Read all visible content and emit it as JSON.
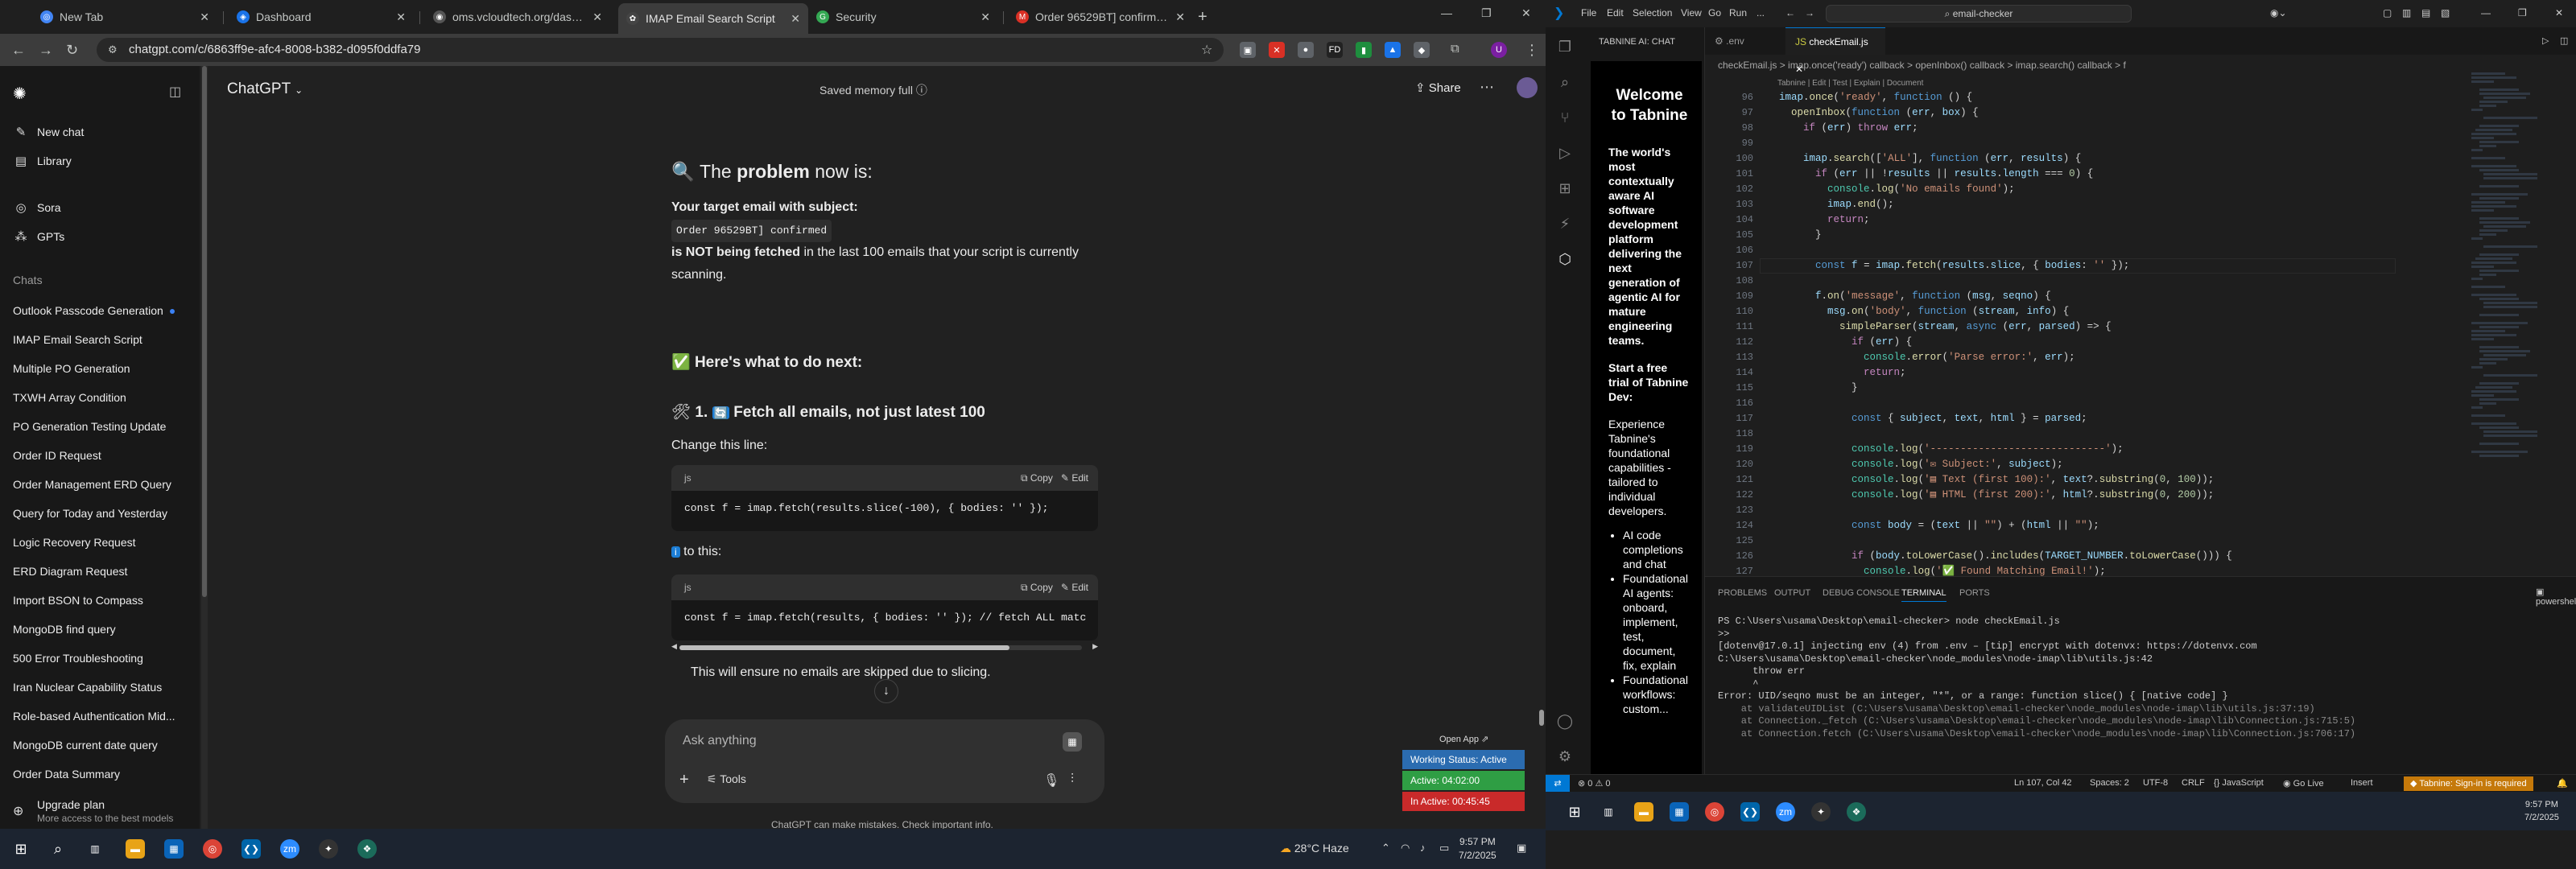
{
  "browser": {
    "tabs": [
      {
        "label": "New Tab",
        "color": "#4285f4"
      },
      {
        "label": "Dashboard",
        "color": "#1a73e8"
      },
      {
        "label": "oms.vcloudtech.org/dashboard",
        "color": "#555555"
      },
      {
        "label": "IMAP Email Search Script",
        "color": "#444444"
      },
      {
        "label": "Security",
        "color": "#34a853"
      },
      {
        "label": "Order 96529BT] confirmed - us",
        "color": "#d93025"
      }
    ],
    "new_tab_glyph": "+",
    "url": "chatgpt.com/c/6863ff9e-afc4-8008-b382-d095f0ddfa79",
    "extensions": [
      {
        "glyph": "▣",
        "color": "#5f6368"
      },
      {
        "glyph": "✕",
        "color": "#d93025"
      },
      {
        "glyph": "●",
        "color": "#5f6368"
      },
      {
        "glyph": "FD",
        "color": "#222222"
      },
      {
        "glyph": "▮",
        "color": "#1e8e3e"
      },
      {
        "glyph": "▲",
        "color": "#1a73e8"
      },
      {
        "glyph": "◆",
        "color": "#5f6368"
      }
    ]
  },
  "chatgpt": {
    "sidebar": {
      "new_chat": "New chat",
      "library": "Library",
      "sora": "Sora",
      "gpts": "GPTs",
      "chats_heading": "Chats",
      "chats": [
        "Outlook Passcode Generation",
        "IMAP Email Search Script",
        "Multiple PO Generation",
        "TXWH Array Condition",
        "PO Generation Testing Update",
        "Order ID Request",
        "Order Management ERD Query",
        "Query for Today and Yesterday",
        "Logic Recovery Request",
        "ERD Diagram Request",
        "Import BSON to Compass",
        "MongoDB find query",
        "500 Error Troubleshooting",
        "Iran Nuclear Capability Status",
        "Role-based Authentication Mid...",
        "MongoDB current date query",
        "Order Data Summary"
      ],
      "upgrade_title": "Upgrade plan",
      "upgrade_sub": "More access to the best models"
    },
    "header": {
      "model": "ChatGPT",
      "memory": "Saved memory full",
      "share": "Share"
    },
    "message": {
      "problem_heading_pre": "The",
      "problem_heading_bold": "problem",
      "problem_heading_post": "now is:",
      "target_label": "Your target email with subject:",
      "subject_code": "Order 96529BT] confirmed",
      "not_fetched_bold": "is NOT being fetched",
      "not_fetched_rest": "in the last 100 emails that your script is currently scanning.",
      "next_heading": "Here's what to do next:",
      "step1_pre": "1.",
      "step1_text": "Fetch",
      "step1_bold": "all emails",
      "step1_post": ", not just latest 100",
      "change_line": "Change this line:",
      "code1_lang": "js",
      "code1": "const f = imap.fetch(results.slice(-100), { bodies: '' });",
      "to_this": "to this:",
      "code2_lang": "js",
      "code2": "const f = imap.fetch(results, { bodies: '' }); // fetch ALL matc",
      "copy_label": "Copy",
      "edit_label": "Edit",
      "ensure_text": "This will ensure no emails are skipped due to slicing."
    },
    "composer": {
      "placeholder": "Ask anything",
      "tools": "Tools"
    },
    "disclaimer": "ChatGPT can make mistakes. Check important info.",
    "widget": {
      "open_app": "Open App",
      "working_status": "Working Status: Active",
      "active": "Active: 04:02:00",
      "in_active": "In Active: 00:45:45",
      "colors": [
        "#2b6cb0",
        "#2f9e44",
        "#c92a2a"
      ]
    }
  },
  "left_taskbar": {
    "weather": "28°C Haze",
    "time": "9:57 PM",
    "date": "7/2/2025"
  },
  "vscode": {
    "menu": [
      "File",
      "Edit",
      "Selection",
      "View",
      "Go",
      "Run",
      "..."
    ],
    "search": "email-checker",
    "chat_panel_title": "TABNINE AI: CHAT",
    "tabnine": {
      "welcome": "Welcome to Tabnine",
      "blurb": "The world's most contextually aware AI software development platform delivering the next generation of agentic AI for mature engineering teams.",
      "trial": "Start a free trial of Tabnine Dev:",
      "experience": "Experience Tabnine's foundational capabilities - tailored to individual developers.",
      "bullets": [
        "AI code completions and chat",
        "Foundational AI agents: onboard, implement, test, document, fix, explain",
        "Foundational workflows: custom..."
      ]
    },
    "tabs": [
      ".env",
      "checkEmail.js"
    ],
    "breadcrumb": "checkEmail.js > imap.once('ready') callback > openInbox() callback > imap.search() callback > f",
    "codelens": "Tabnine | Edit | Test | Explain | Document",
    "first_line": 96,
    "panel_tabs": [
      "PROBLEMS",
      "OUTPUT",
      "DEBUG CONSOLE",
      "TERMINAL",
      "PORTS"
    ],
    "shell": "powershell",
    "terminal": [
      "PS C:\\Users\\usama\\Desktop\\email-checker> node checkEmail.js",
      ">>",
      "[dotenv@17.0.1] injecting env (4) from .env – [tip] encrypt with dotenvx: https://dotenvx.com",
      "C:\\Users\\usama\\Desktop\\email-checker\\node_modules\\node-imap\\lib\\utils.js:42",
      "      throw err",
      "      ^",
      "",
      "Error: UID/seqno must be an integer, \"*\", or a range: function slice() { [native code] }",
      "    at validateUIDList (C:\\Users\\usama\\Desktop\\email-checker\\node_modules\\node-imap\\lib\\utils.js:37:19)",
      "    at Connection._fetch (C:\\Users\\usama\\Desktop\\email-checker\\node_modules\\node-imap\\lib\\Connection.js:715:5)",
      "    at Connection.fetch (C:\\Users\\usama\\Desktop\\email-checker\\node_modules\\node-imap\\lib\\Connection.js:706:17)"
    ],
    "status": {
      "problems": "⊗ 0  ⚠ 0",
      "position": "Ln 107, Col 42",
      "spaces": "Spaces: 2",
      "encoding": "UTF-8",
      "eol": "CRLF",
      "language": "{} JavaScript",
      "golive": "Go Live",
      "insert": "Insert",
      "tabnine": "Tabnine: Sign-in is required"
    },
    "time": "9:57 PM",
    "date": "7/2/2025"
  }
}
